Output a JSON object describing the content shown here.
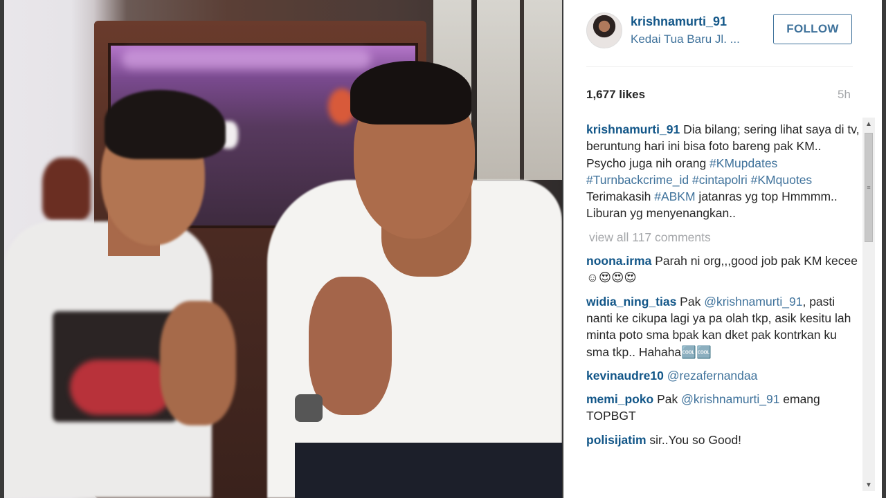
{
  "post": {
    "username": "krishnamurti_91",
    "location": "Kedai Tua Baru Jl. ...",
    "follow_label": "FOLLOW",
    "likes": "1,677 likes",
    "time": "5h"
  },
  "caption": {
    "user": "krishnamurti_91",
    "text_1": " Dia bilang; sering lihat saya di tv, beruntung hari ini bisa foto bareng pak KM.. Psycho juga nih orang ",
    "tags_1": "#KMupdates #Turnbackcrime_id #cintapolri #KMquotes",
    "text_2": " Terimakasih ",
    "tag_2": "#ABKM",
    "text_3": " jatanras yg top Hmmmm.. Liburan yg menyenangkan.."
  },
  "view_all": "view all 117 comments",
  "comments": [
    {
      "user": "noona.irma",
      "text": " Parah ni org,,,good job pak KM kecee ☺😍😍😍"
    },
    {
      "user": "widia_ning_tias",
      "pre": " Pak ",
      "mention": "@krishnamurti_91",
      "text": ", pasti nanti ke cikupa lagi ya pa olah tkp, asik kesitu lah minta poto sma bpak kan dket pak kontrkan ku sma tkp.. Hahaha🆒🆒"
    },
    {
      "user": "kevinaudre10",
      "mention": " @rezafernandaa"
    },
    {
      "user": "memi_poko",
      "pre": " Pak ",
      "mention": "@krishnamurti_91",
      "text": " emang TOPBGT"
    },
    {
      "user": "polisijatim",
      "text": " sir..You so Good!"
    }
  ],
  "icons": {
    "scroll_up": "triangle-up",
    "scroll_down": "triangle-down"
  }
}
